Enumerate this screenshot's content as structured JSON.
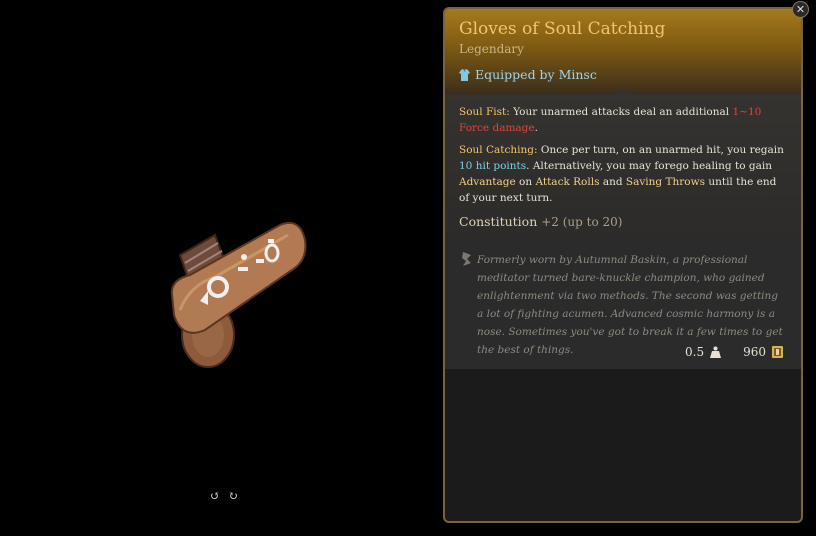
{
  "item": {
    "name": "Gloves of Soul Catching",
    "rarity": "Legendary",
    "equipped_text": "Equipped by Minsc"
  },
  "abilities": {
    "soul_fist": {
      "title": "Soul Fist:",
      "text_before": "Your unarmed attacks deal an additional",
      "damage": "1~10 Force damage",
      "text_after": "."
    },
    "soul_catching": {
      "title": "Soul Catching:",
      "text_1": "Once per turn, on an unarmed hit, you regain",
      "heal": "10 hit points",
      "text_2": ". Alternatively, you may forego healing to gain",
      "advantage": "Advantage",
      "text_3": "on",
      "attack_rolls": "Attack Rolls",
      "text_4": "and",
      "saving_throws": "Saving Throws",
      "text_5": "until the end of your next turn."
    }
  },
  "stat_bonus": {
    "label": "Constitution",
    "value": "+2 (up to 20)"
  },
  "flavor_text": "Formerly worn by Autumnal Baskin, a professional meditator turned bare-knuckle champion, who gained enlightenment via two methods. The second was getting a lot of fighting acumen. Advanced cosmic harmony is a nose. Sometimes you've got to break it a few times to get the best of things.",
  "stats": {
    "weight": "0.5",
    "value": "960"
  },
  "colors": {
    "header_gold": "#a67a1c",
    "name_color": "#f2c56a",
    "damage_red": "#e0443d",
    "heal_blue": "#7fd0e9",
    "panel_border": "#7a6240"
  },
  "icons": {
    "close": "close-icon",
    "equipped": "shirt-icon",
    "flavor": "quill-icon",
    "weight": "weight-icon",
    "value": "gold-coin-icon",
    "rotate_left": "rotate-left-icon",
    "rotate_right": "rotate-right-icon"
  }
}
